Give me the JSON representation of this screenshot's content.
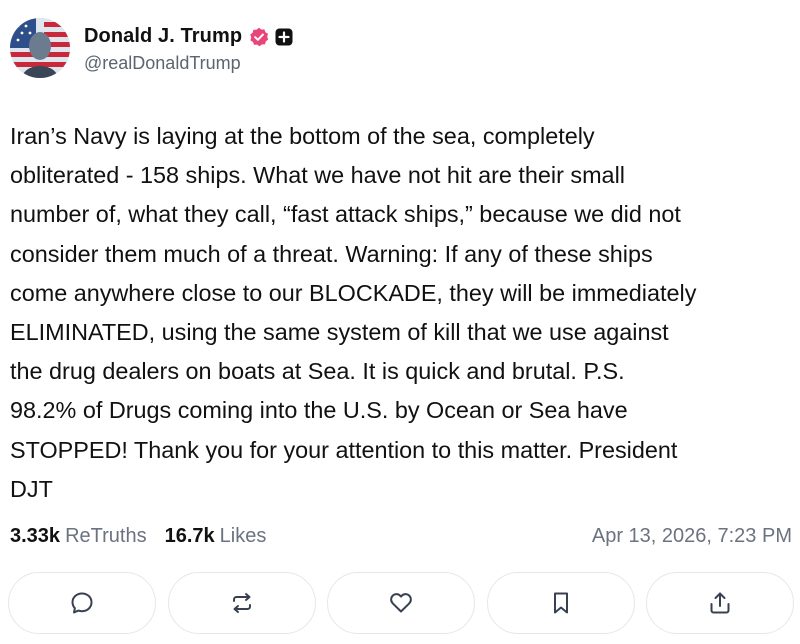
{
  "author": {
    "display_name": "Donald J. Trump",
    "handle": "@realDonaldTrump",
    "avatar_icon": "avatar-flag-portrait",
    "verified_color": "#e8457a"
  },
  "post": {
    "lines": [
      "Iran’s Navy is laying at the bottom of the sea, completely",
      "obliterated - 158 ships. What we have not hit are their small",
      "number of, what they call, “fast attack ships,” because we did not",
      "consider them much of a threat. Warning: If any of these ships",
      "come anywhere close to our BLOCKADE, they will be immediately",
      "ELIMINATED, using the same system of kill that we use against",
      "the drug dealers on boats at Sea. It is quick and brutal. P.S.",
      "98.2% of Drugs coming into the U.S. by Ocean or Sea have",
      "STOPPED! Thank you for your attention to this matter. President",
      "DJT"
    ]
  },
  "stats": {
    "retruths_count": "3.33k",
    "retruths_label": "ReTruths",
    "likes_count": "16.7k",
    "likes_label": "Likes",
    "timestamp": "Apr 13, 2026, 7:23 PM"
  },
  "actions": [
    {
      "name": "reply",
      "icon": "comment-icon"
    },
    {
      "name": "retruth",
      "icon": "repost-icon"
    },
    {
      "name": "like",
      "icon": "heart-icon"
    },
    {
      "name": "bookmark",
      "icon": "bookmark-icon"
    },
    {
      "name": "share",
      "icon": "share-icon"
    }
  ]
}
